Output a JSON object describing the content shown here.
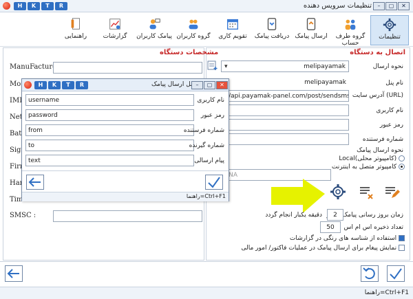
{
  "window": {
    "title": "تنظیمات سرویس دهنده",
    "quick_buttons": [
      "H",
      "K",
      "T",
      "R"
    ]
  },
  "toolbar": {
    "items": [
      {
        "label": "تنظیمات",
        "icon": "gear-icon"
      },
      {
        "label": "گروه طرف حساب",
        "icon": "users-group-icon"
      },
      {
        "label": "ارسال پیامک",
        "icon": "send-sms-icon"
      },
      {
        "label": "دریافت پیامک",
        "icon": "receive-sms-icon"
      },
      {
        "label": "تقویم کاری",
        "icon": "calendar-icon"
      },
      {
        "label": "گروه کاربران",
        "icon": "user-group-icon"
      },
      {
        "label": "پیامک کاربران",
        "icon": "user-sms-icon"
      },
      {
        "label": "گزارشات",
        "icon": "report-chart-icon"
      },
      {
        "label": "راهنمایی",
        "icon": "help-book-icon"
      }
    ]
  },
  "right_panel": {
    "title": "اتصال به دستگاه",
    "send_type_label": "نحوه ارسال",
    "send_type_value": "melipayamak",
    "panel_name_label": "نام پنل",
    "panel_name_value": "melipayamak",
    "url_label": "آدرس سایت (URL)",
    "url_value": "://api.payamak-panel.com/post/sendsms.ashx?",
    "username_label": "نام کاربری",
    "password_label": "رمز عبور",
    "password_value": "x",
    "sender_label": "شماره فرستنده",
    "method_label": "نحوه ارسال پیامک",
    "method_local": "Local(کامپیوتر محلی)",
    "method_internet": "کامپیوتر متصل به اینترنت",
    "port_value": "ANA",
    "interval_label": "زمان بروز رسانی پیامک ها هر",
    "interval_value": "2",
    "interval_suffix": "دقیقه یکبار انجام گردد",
    "archive_label": "تعداد ذخیره اس ام اس",
    "archive_value": "50",
    "color_check_label": "استفاده از شناسه های رنگی در گزارشات",
    "invoice_check_label": "نمایش پیغام برای ارسال پیامک در عملیات فاکتور/ امور مالی"
  },
  "left_panel": {
    "title": "مشخصات دستگاه",
    "manufacture_label": "ManuFacture :",
    "model_label": "Mo",
    "imei_label": "IMI",
    "network_label": "Net",
    "battery_label": "Batt",
    "signal_label": "Sigr",
    "firmware_label": "Firm",
    "hardware_label": "Har",
    "time_label": "Tim",
    "smsc_label": "SMSC :"
  },
  "dialog": {
    "title": "پنل ارسال پیامک",
    "fields": [
      {
        "label": "نام کاربری",
        "value": "username"
      },
      {
        "label": "رمز عبور",
        "value": "password"
      },
      {
        "label": "شماره فرستنده",
        "value": "from"
      },
      {
        "label": "شماره گیرنده",
        "value": "to"
      },
      {
        "label": "پیام ارسالی",
        "value": "text"
      }
    ],
    "help_text": "راهنما=Ctrl+F1"
  },
  "statusbar": {
    "help_text": "راهنما=Ctrl+F1"
  },
  "colors": {
    "accent_blue": "#2f6fc3",
    "section_red": "#c62828",
    "highlight_arrow": "#e6f200"
  }
}
